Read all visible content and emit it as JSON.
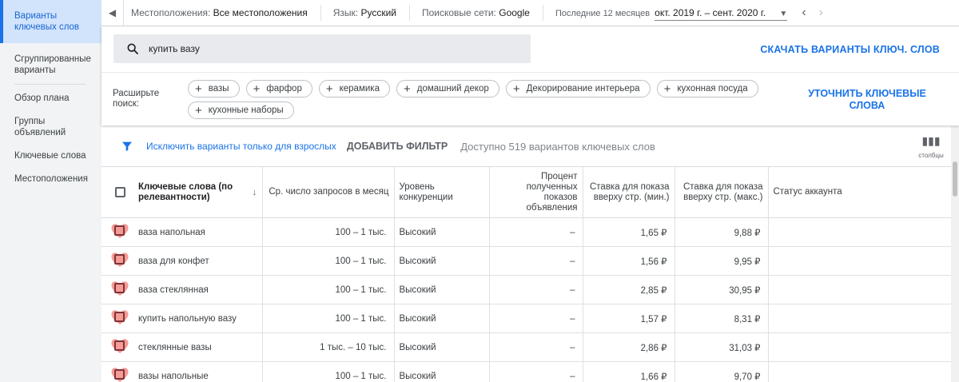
{
  "sidebar": {
    "items": [
      {
        "label": "Варианты ключевых слов"
      },
      {
        "label": "Сгруппированные варианты"
      },
      {
        "label": "Обзор плана"
      },
      {
        "label": "Группы объявлений"
      },
      {
        "label": "Ключевые слова"
      },
      {
        "label": "Местоположения"
      }
    ]
  },
  "topbar": {
    "location_label": "Местоположения:",
    "location_value": "Все местоположения",
    "language_label": "Язык:",
    "language_value": "Русский",
    "network_label": "Поисковые сети:",
    "network_value": "Google",
    "period_label": "Последние 12 месяцев",
    "date_range": "окт. 2019 г. – сент. 2020 г."
  },
  "search": {
    "query": "купить вазу",
    "download_label": "СКАЧАТЬ ВАРИАНТЫ КЛЮЧ. СЛОВ"
  },
  "expand": {
    "label": "Расширьте поиск:",
    "chips": [
      "вазы",
      "фарфор",
      "керамика",
      "домашний декор",
      "Декорирование интерьера",
      "кухонная посуда",
      "кухонные наборы"
    ],
    "refine_label": "УТОЧНИТЬ КЛЮЧЕВЫЕ СЛОВА"
  },
  "filter": {
    "exclude_adult_label": "Исключить варианты только для взрослых",
    "add_filter_label": "ДОБАВИТЬ ФИЛЬТР",
    "available_label": "Доступно 519 вариантов ключевых слов",
    "columns_label": "столбцы"
  },
  "table": {
    "headers": {
      "keyword": "Ключевые слова (по релевантности)",
      "searches": "Ср. число запросов в месяц",
      "competition": "Уровень конкуренции",
      "impression_share": "Процент полученных показов объявления",
      "bid_low": "Ставка для показа вверху стр. (мин.)",
      "bid_high": "Ставка для показа вверху стр. (макс.)",
      "status": "Статус аккаунта"
    },
    "rows": [
      {
        "keyword": "ваза напольная",
        "searches": "100 – 1 тыс.",
        "competition": "Высокий",
        "impression_share": "–",
        "bid_low": "1,65 ₽",
        "bid_high": "9,88 ₽",
        "status": ""
      },
      {
        "keyword": "ваза для конфет",
        "searches": "100 – 1 тыс.",
        "competition": "Высокий",
        "impression_share": "–",
        "bid_low": "1,56 ₽",
        "bid_high": "9,95 ₽",
        "status": ""
      },
      {
        "keyword": "ваза стеклянная",
        "searches": "100 – 1 тыс.",
        "competition": "Высокий",
        "impression_share": "–",
        "bid_low": "2,85 ₽",
        "bid_high": "30,95 ₽",
        "status": ""
      },
      {
        "keyword": "купить напольную вазу",
        "searches": "100 – 1 тыс.",
        "competition": "Высокий",
        "impression_share": "–",
        "bid_low": "1,57 ₽",
        "bid_high": "8,31 ₽",
        "status": ""
      },
      {
        "keyword": "стеклянные вазы",
        "searches": "1 тыс. – 10 тыс.",
        "competition": "Высокий",
        "impression_share": "–",
        "bid_low": "2,86 ₽",
        "bid_high": "31,03 ₽",
        "status": ""
      },
      {
        "keyword": "вазы напольные",
        "searches": "100 – 1 тыс.",
        "competition": "Высокий",
        "impression_share": "–",
        "bid_low": "1,66 ₽",
        "bid_high": "9,70 ₽",
        "status": ""
      }
    ]
  },
  "colors": {
    "accent": "#1a73e8",
    "active_nav_bg": "#d2e3fc",
    "heart_marker": "#f28b82"
  }
}
